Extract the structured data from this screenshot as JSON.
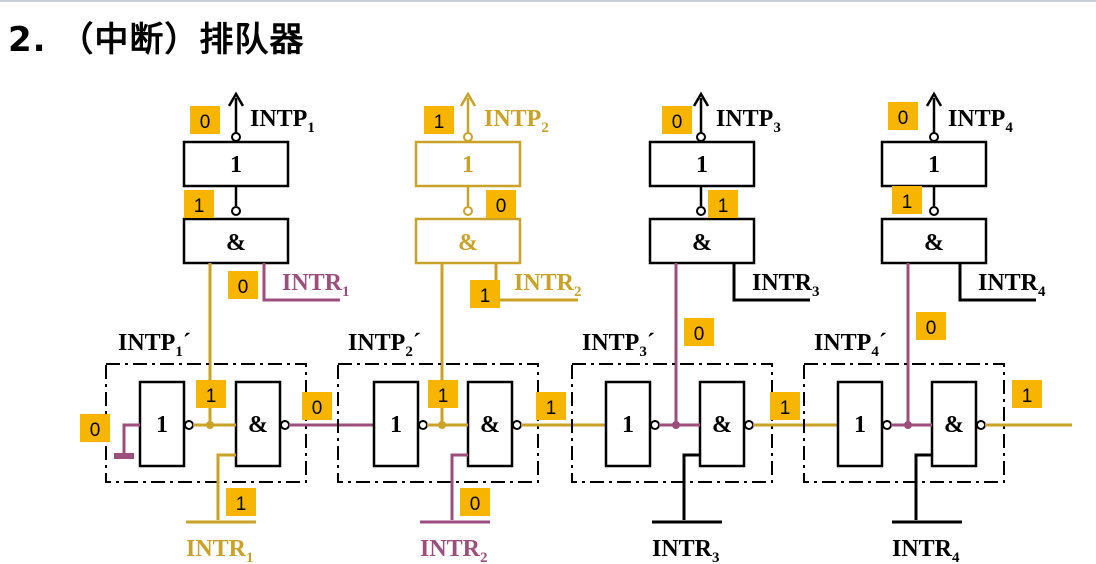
{
  "title": "2. （中断）排队器",
  "colors": {
    "black": "#000000",
    "gold": "#c9a227",
    "purple": "#9c4f7c",
    "value_box": "#f7b500"
  },
  "gates": {
    "not": "1",
    "and": "&"
  },
  "channels": [
    {
      "intp": "INTP1",
      "intp_prime": "INTP1´",
      "intr": "INTR1",
      "intr_bar": "INTR1",
      "intp_value": "0",
      "not_out_value": "1",
      "intr_value": "0",
      "chain_in_value": "0",
      "chain_mid_value": "1",
      "chain_out_value": "0",
      "intr_bar_value": "1"
    },
    {
      "intp": "INTP2",
      "intp_prime": "INTP2´",
      "intr": "INTR2",
      "intr_bar": "INTR2",
      "intp_value": "1",
      "not_out_value": "0",
      "intr_value": "1",
      "chain_mid_value": "1",
      "chain_out_value": "1",
      "intr_bar_value": "0"
    },
    {
      "intp": "INTP3",
      "intp_prime": "INTP3´",
      "intr": "INTR3",
      "intr_bar": "INTR3",
      "intp_value": "0",
      "not_out_value": "1",
      "prime_value": "0",
      "chain_out_value": "1"
    },
    {
      "intp": "INTP4",
      "intp_prime": "INTP4´",
      "intr": "INTR4",
      "intr_bar": "INTR4",
      "intp_value": "0",
      "not_out_value": "1",
      "prime_value": "0",
      "chain_out_value": "1"
    }
  ]
}
